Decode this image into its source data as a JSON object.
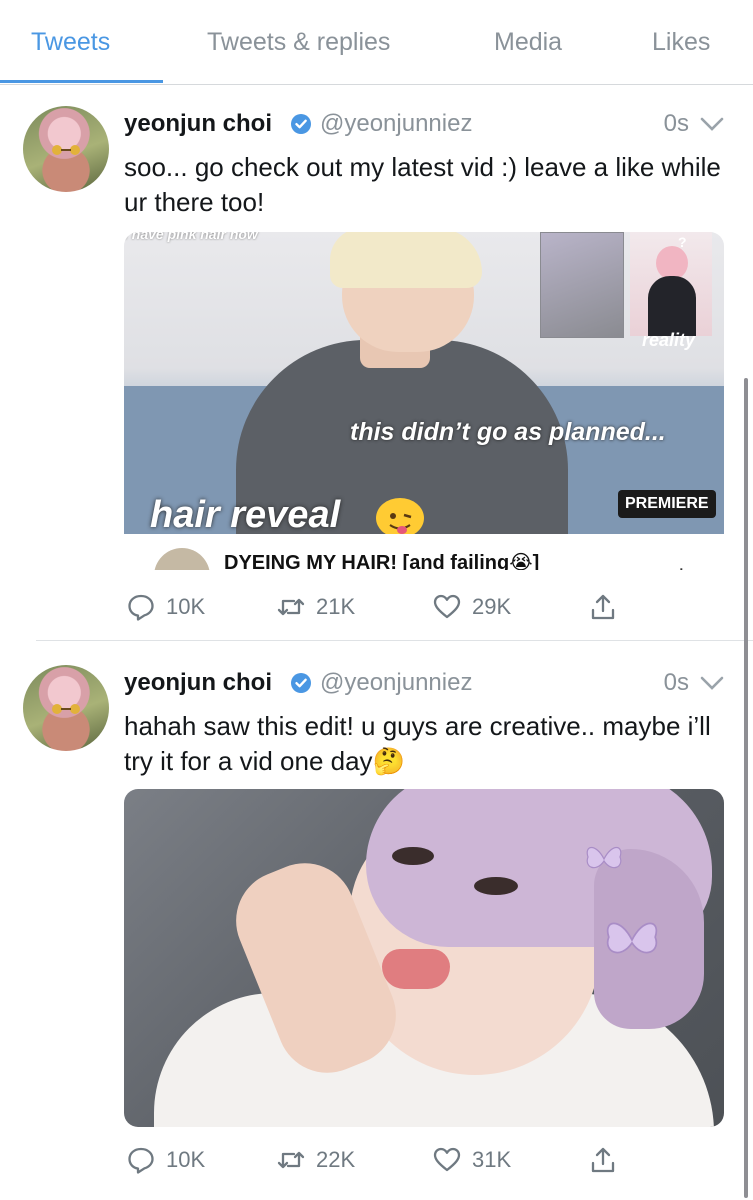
{
  "tabs": [
    {
      "label": "Tweets",
      "active": true
    },
    {
      "label": "Tweets & replies",
      "active": false
    },
    {
      "label": "Media",
      "active": false
    },
    {
      "label": "Likes",
      "active": false
    }
  ],
  "colors": {
    "accent": "#4a97e3",
    "muted": "#8a9299",
    "verified": "#4a97e3"
  },
  "tweets": [
    {
      "name": "yeonjun choi",
      "handle": "@yeonjunniez",
      "time": "0s",
      "text": "soo... go check out my latest vid :) leave a like while ur there too!",
      "media": {
        "top_text": "I have pink hair now",
        "reality_label": "reality",
        "caption": "this didn’t go as planned...",
        "title_overlay": "hair reveal",
        "badge": "PREMIERE",
        "video_title": "DYEING MY HAIR! [and failing😭]"
      },
      "replies": "10K",
      "retweets": "21K",
      "likes": "29K"
    },
    {
      "name": "yeonjun choi",
      "handle": "@yeonjunniez",
      "time": "0s",
      "text": "hahah saw this edit! u guys are creative.. maybe i’ll try it for a vid one day🤔",
      "replies": "10K",
      "retweets": "22K",
      "likes": "31K"
    }
  ]
}
